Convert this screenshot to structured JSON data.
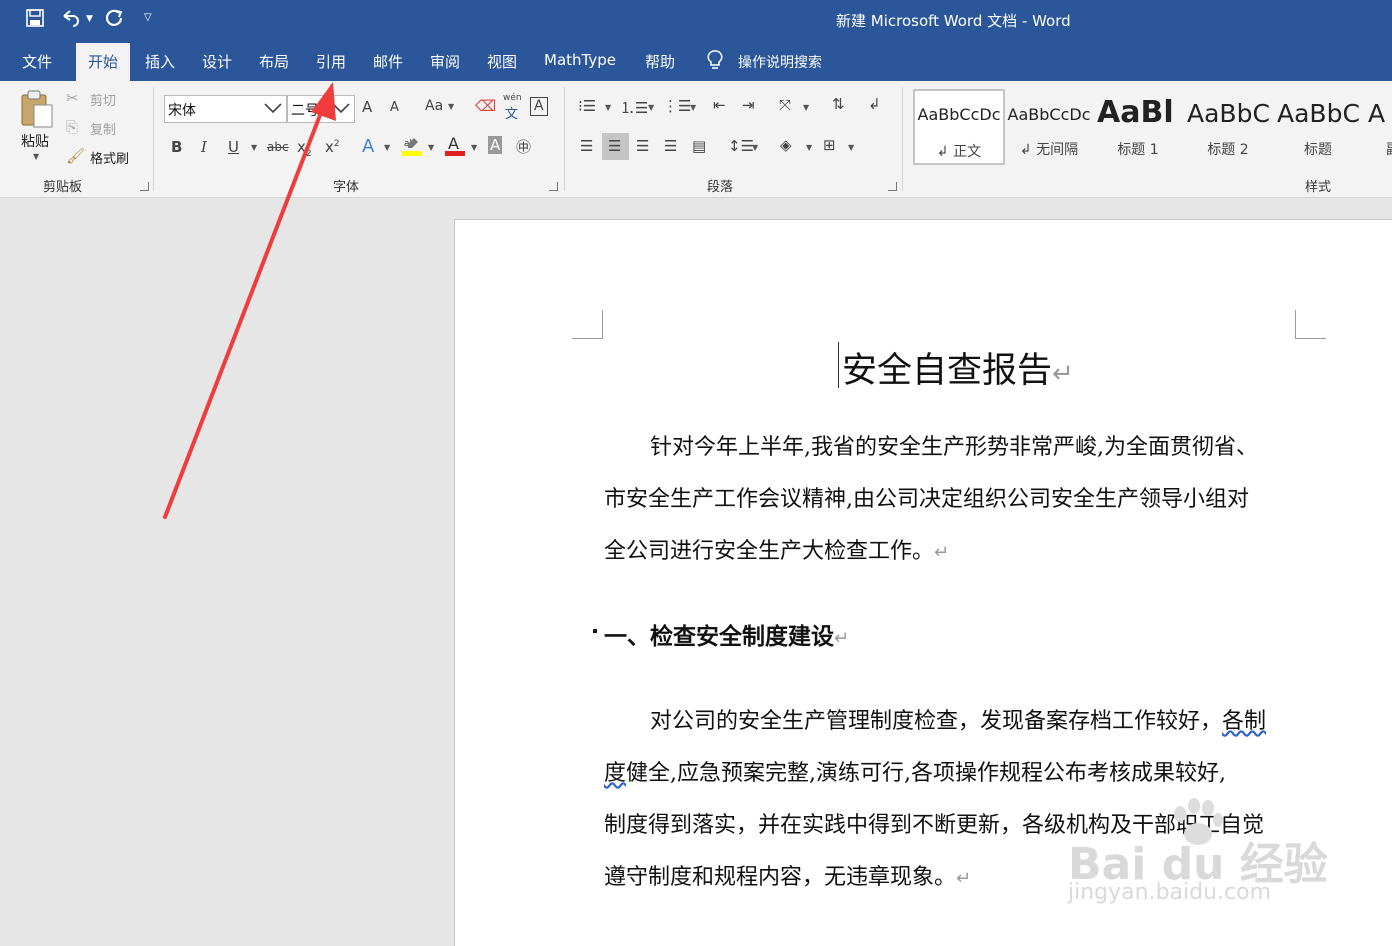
{
  "titlebar": {
    "title": "新建 Microsoft Word 文档  -  Word"
  },
  "tabs": [
    {
      "label": "文件"
    },
    {
      "label": "开始"
    },
    {
      "label": "插入"
    },
    {
      "label": "设计"
    },
    {
      "label": "布局"
    },
    {
      "label": "引用"
    },
    {
      "label": "邮件"
    },
    {
      "label": "审阅"
    },
    {
      "label": "视图"
    },
    {
      "label": "MathType"
    },
    {
      "label": "帮助"
    }
  ],
  "search": {
    "label": "操作说明搜索"
  },
  "clipboard": {
    "paste": "粘贴",
    "cut": "剪切",
    "copy": "复制",
    "format_painter": "格式刷",
    "group_label": "剪贴板"
  },
  "font": {
    "font_name": "宋体",
    "font_size": "二号",
    "group_label": "字体",
    "bold": "B",
    "italic": "I",
    "underline": "U",
    "strike": "abc",
    "subscript": "x",
    "superscript": "x",
    "change_case": "Aa",
    "grow": "A",
    "shrink": "A",
    "phonetic_top": "wén",
    "phonetic_bottom": "文",
    "char_border": "A"
  },
  "paragraph": {
    "group_label": "段落"
  },
  "styles": {
    "group_label": "样式",
    "items": [
      {
        "preview": "AaBbCcDc",
        "name": "↲ 正文"
      },
      {
        "preview": "AaBbCcDc",
        "name": "↲ 无间隔"
      },
      {
        "preview": "AaBl",
        "name": "标题 1"
      },
      {
        "preview": "AaBbC",
        "name": "标题 2"
      },
      {
        "preview": "AaBbC",
        "name": "标题"
      },
      {
        "preview": "A",
        "name": "副"
      }
    ]
  },
  "document": {
    "title": "安全自查报告",
    "para1": [
      "针对今年上半年,我省的安全生产形势非常严峻,为全面贯彻省、",
      "市安全生产工作会议精神,由公司决定组织公司安全生产领导小组对",
      "全公司进行安全生产大检查工作。"
    ],
    "heading1": "一、检查安全制度建设",
    "para2": [
      "对公司的安全生产管理制度检查，发现备案存档工作较好，各制",
      "度健全,应急预案完整,演练可行,各项操作规程公布考核成果较好,",
      "制度得到落实，并在实践中得到不断更新，各级机构及干部职工自觉",
      "遵守制度和规程内容，无违章现象。"
    ],
    "para2_line1_main": "对公司的安全生产管理制度检查，发现备案存档工作较好，",
    "para2_line1_wavy": "各制",
    "para2_line2_wavy": "度",
    "para2_line2_rest": "健全,应急预案完整,演练可行,各项操作规程公布考核成果较好,",
    "pilcrow": "↵"
  },
  "watermark": {
    "brand": "Bai du 经验",
    "url": "jingyan.baidu.com"
  },
  "colors": {
    "accent": "#2b579a",
    "arrow": "#f03c3c"
  }
}
